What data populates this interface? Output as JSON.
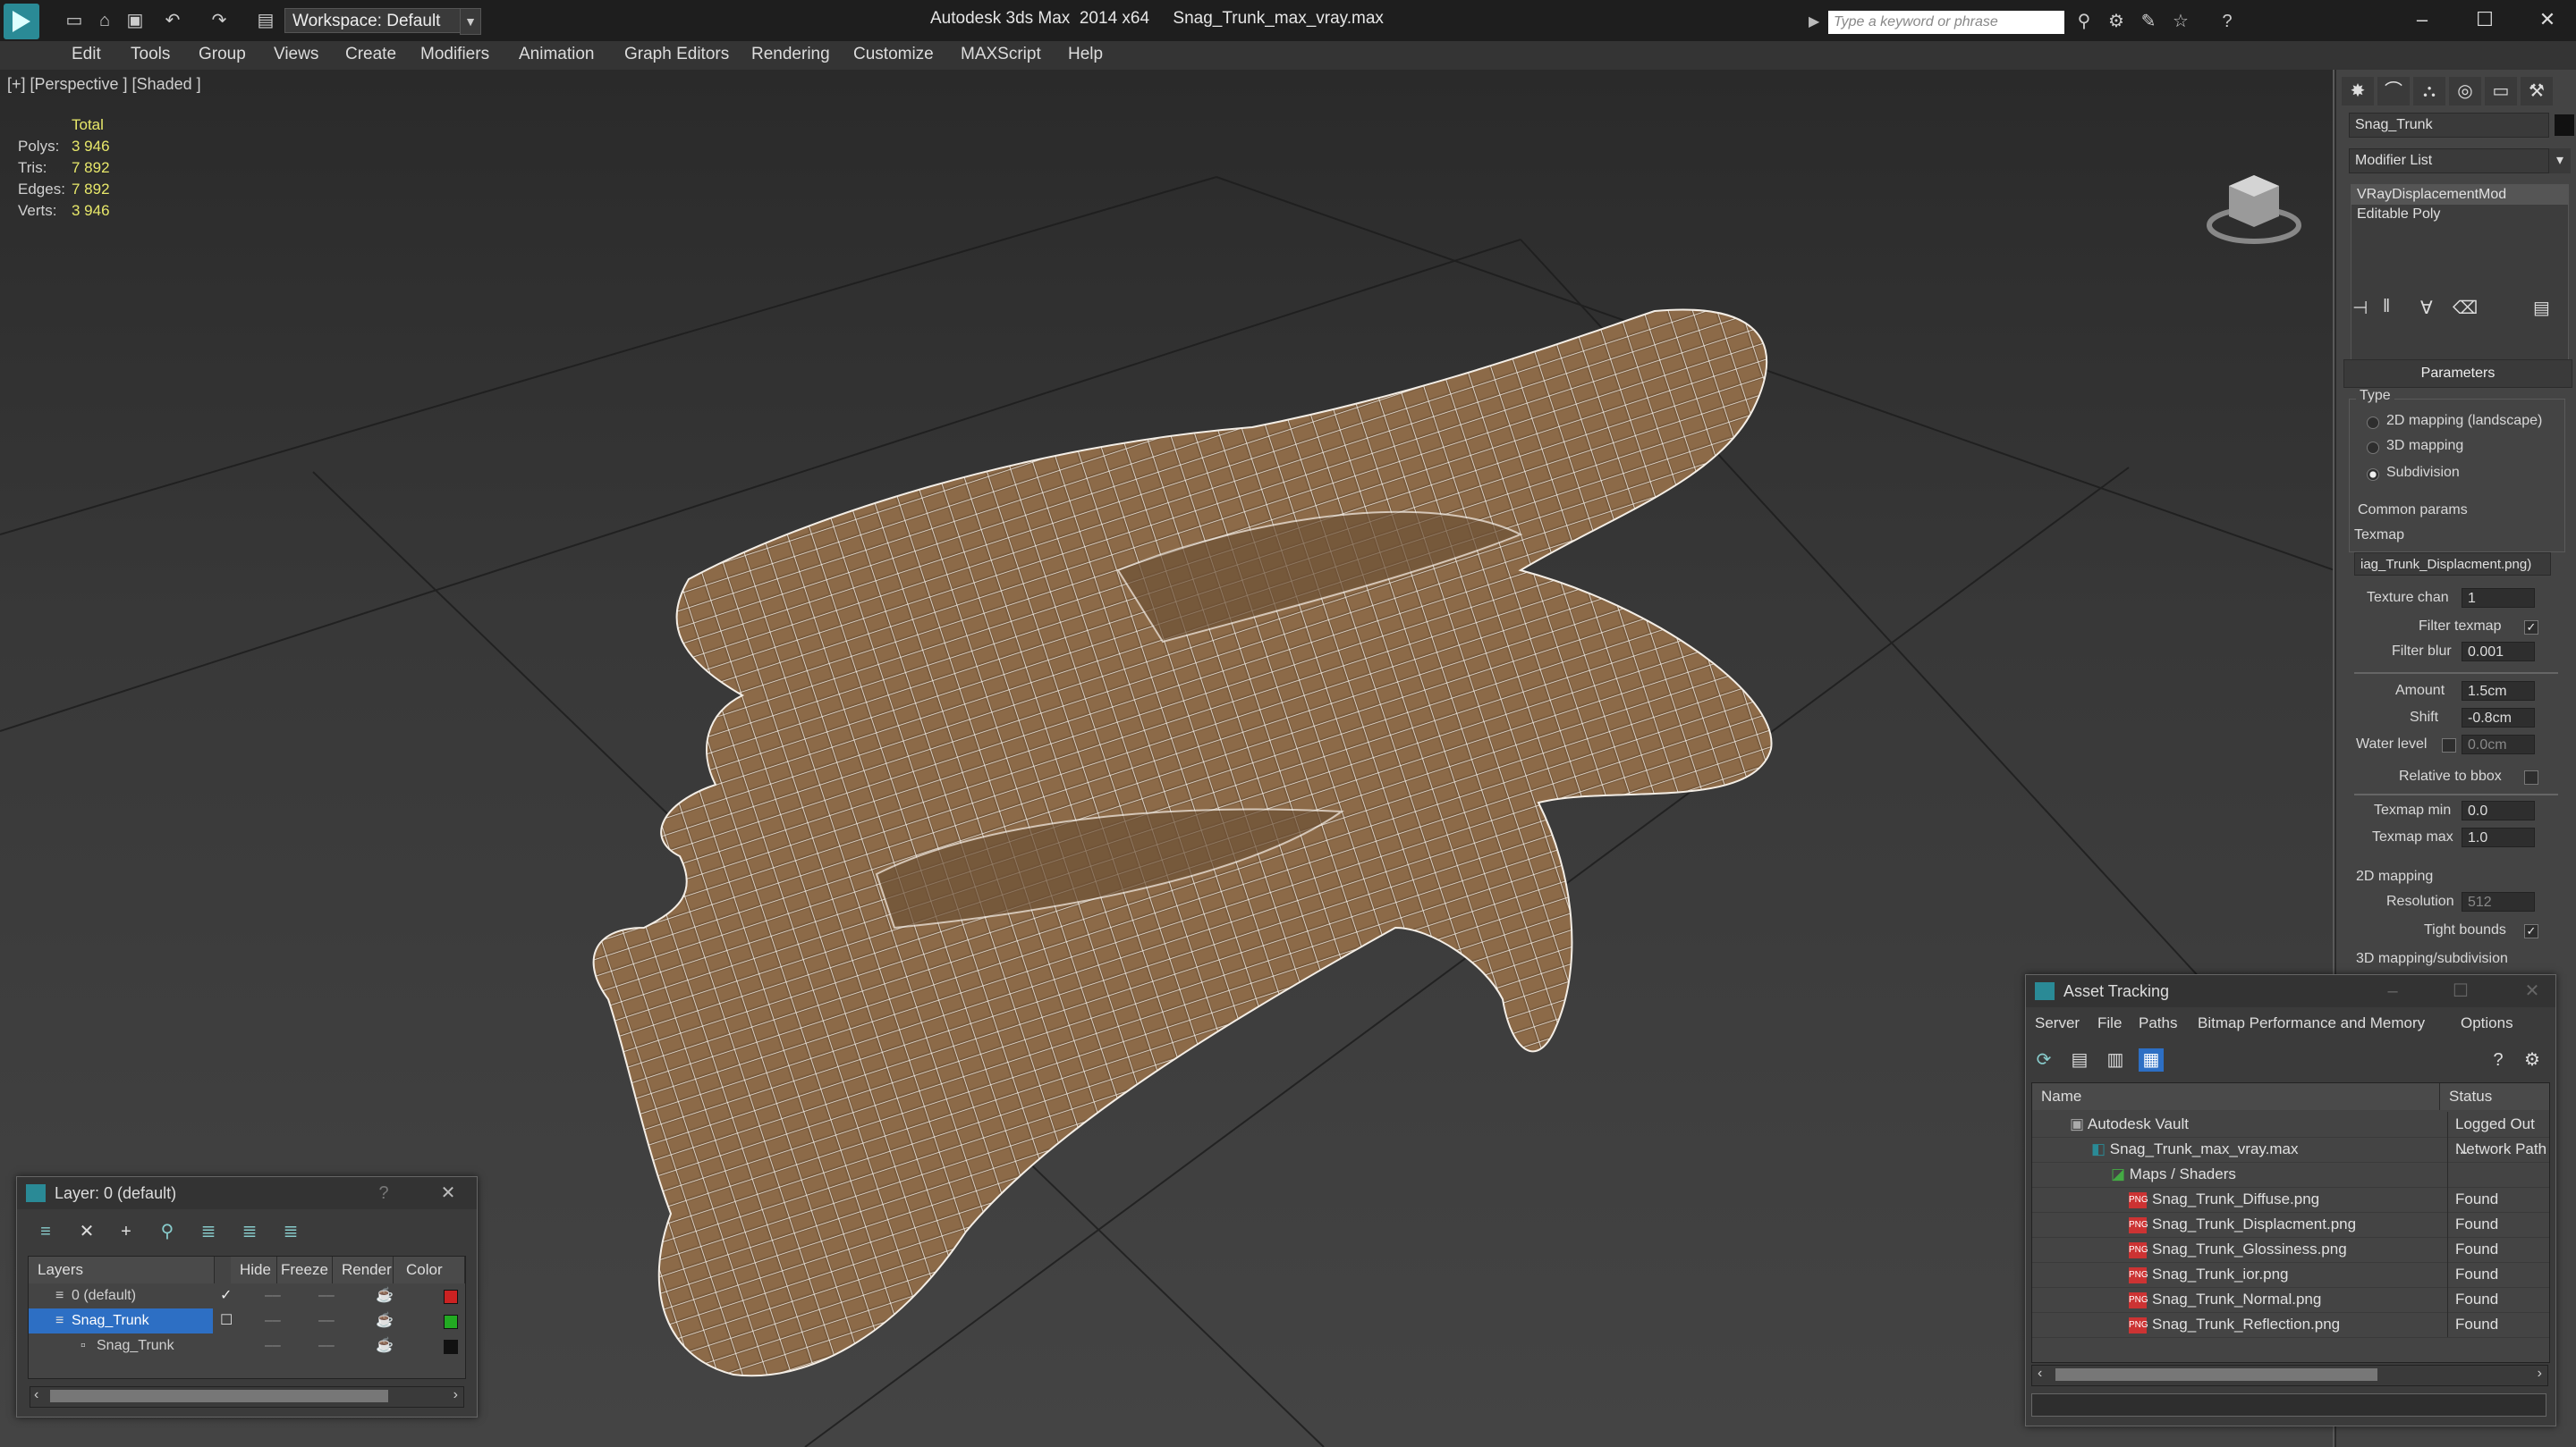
{
  "app": {
    "title": "Autodesk 3ds Max  2014 x64     Snag_Trunk_max_vray.max",
    "workspace": "Workspace: Default",
    "search_placeholder": "Type a keyword or phrase"
  },
  "menu": [
    "Edit",
    "Tools",
    "Group",
    "Views",
    "Create",
    "Modifiers",
    "Animation",
    "Graph Editors",
    "Rendering",
    "Customize",
    "MAXScript",
    "Help"
  ],
  "viewport": {
    "label": "[+] [Perspective ] [Shaded ]",
    "stats_header": "Total",
    "stats": [
      {
        "label": "Polys:",
        "value": "3 946"
      },
      {
        "label": "Tris:",
        "value": "7 892"
      },
      {
        "label": "Edges:",
        "value": "7 892"
      },
      {
        "label": "Verts:",
        "value": "3 946"
      }
    ]
  },
  "command_panel": {
    "object_name": "Snag_Trunk",
    "modifier_list": "Modifier List",
    "stack": [
      "VRayDisplacementMod",
      "Editable Poly"
    ],
    "rollout": "Parameters",
    "type_label": "Type",
    "types": [
      {
        "label": "2D mapping (landscape)",
        "selected": false
      },
      {
        "label": "3D mapping",
        "selected": false
      },
      {
        "label": "Subdivision",
        "selected": true
      }
    ],
    "common_params": "Common params",
    "texmap_label": "Texmap",
    "texmap_value": "iag_Trunk_Displacment.png)",
    "params": [
      {
        "label": "Texture chan",
        "value": "1"
      },
      {
        "label": "Filter blur",
        "value": "0.001"
      },
      {
        "label": "Amount",
        "value": "1.5cm"
      },
      {
        "label": "Shift",
        "value": "-0.8cm"
      },
      {
        "label": "Water level",
        "value": "0.0cm"
      },
      {
        "label": "Texmap min",
        "value": "0.0"
      },
      {
        "label": "Texmap max",
        "value": "1.0"
      },
      {
        "label": "Resolution",
        "value": "512"
      }
    ],
    "filter_texmap": "Filter texmap",
    "relative_bbox": "Relative to bbox",
    "mapping_2d": "2D mapping",
    "tight_bounds": "Tight bounds",
    "mapping_3d": "3D mapping/subdivision"
  },
  "layer_window": {
    "title": "Layer: 0 (default)",
    "help": "?",
    "columns": [
      "Layers",
      "Hide",
      "Freeze",
      "Render",
      "Color"
    ],
    "rows": [
      {
        "name": "0 (default)",
        "color": "#cc2222"
      },
      {
        "name": "Snag_Trunk",
        "color": "#22aa22"
      },
      {
        "name": "Snag_Trunk",
        "color": "#111111"
      }
    ]
  },
  "asset_tracking": {
    "title": "Asset Tracking",
    "menu": [
      "Server",
      "File",
      "Paths",
      "Bitmap Performance and Memory",
      "Options"
    ],
    "columns": [
      "Name",
      "Status"
    ],
    "rows": [
      {
        "name": "Autodesk Vault",
        "status": "Logged Out ..."
      },
      {
        "name": "Snag_Trunk_max_vray.max",
        "status": "Network Path"
      },
      {
        "name": "Maps / Shaders",
        "status": ""
      },
      {
        "name": "Snag_Trunk_Diffuse.png",
        "status": "Found"
      },
      {
        "name": "Snag_Trunk_Displacment.png",
        "status": "Found"
      },
      {
        "name": "Snag_Trunk_Glossiness.png",
        "status": "Found"
      },
      {
        "name": "Snag_Trunk_ior.png",
        "status": "Found"
      },
      {
        "name": "Snag_Trunk_Normal.png",
        "status": "Found"
      },
      {
        "name": "Snag_Trunk_Reflection.png",
        "status": "Found"
      }
    ]
  }
}
